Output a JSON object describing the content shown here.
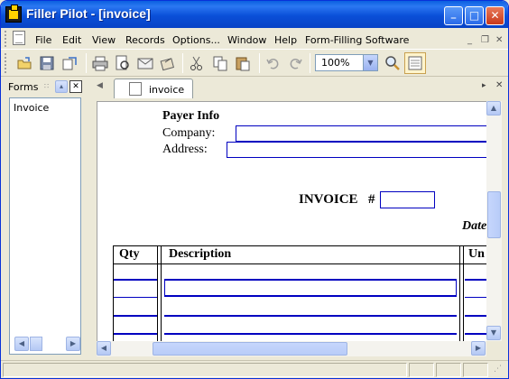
{
  "window": {
    "title": "Filler Pilot - [invoice]",
    "controls": {
      "minimize": "_",
      "maximize": "□",
      "close": "✕"
    }
  },
  "menubar": {
    "items": [
      "File",
      "Edit",
      "View",
      "Records",
      "Options...",
      "Window",
      "Help",
      "Form-Filling Software"
    ],
    "mdi_controls": {
      "minimize": "_",
      "restore": "❐",
      "close": "✕"
    }
  },
  "toolbar": {
    "zoom_value": "100%",
    "icons": [
      "open-icon",
      "save-icon",
      "export-icon",
      "print-icon",
      "print-preview-icon",
      "email-icon",
      "attach-icon",
      "cut-icon",
      "copy-icon",
      "paste-icon",
      "undo-icon",
      "redo-icon",
      "zoom-icon",
      "form-view-icon"
    ]
  },
  "forms_panel": {
    "title": "Forms",
    "items": [
      "Invoice"
    ]
  },
  "document_tabs": [
    {
      "label": "invoice"
    }
  ],
  "invoice_form": {
    "payer_info_heading": "Payer Info",
    "company_label": "Company:",
    "address_label": "Address:",
    "invoice_label": "INVOICE",
    "invoice_hash": "#",
    "date_label": "Date",
    "columns": [
      "Qty",
      "Description",
      "Un"
    ]
  },
  "colors": {
    "titlebar": "#0a4fd8",
    "field_border": "#0000c0",
    "chrome": "#ece9d8"
  }
}
